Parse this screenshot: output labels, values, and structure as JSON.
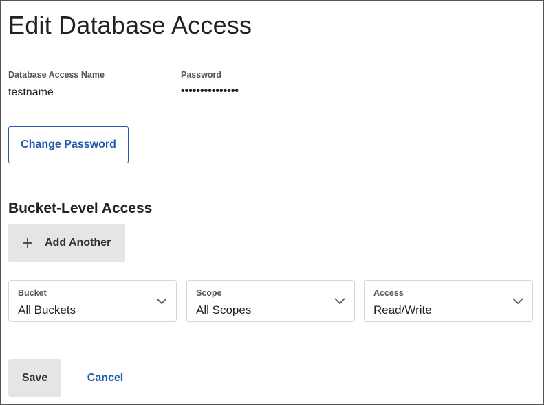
{
  "page": {
    "title": "Edit Database Access"
  },
  "credentials": {
    "name_label": "Database Access Name",
    "name_value": "testname",
    "password_label": "Password",
    "password_value": "•••••••••••••••"
  },
  "actions": {
    "change_password_label": "Change Password",
    "save_label": "Save",
    "cancel_label": "Cancel"
  },
  "bucket_access": {
    "section_title": "Bucket-Level Access",
    "add_another_label": "Add Another",
    "add_icon": "plus-icon",
    "dropdown_icon": "chevron-down-icon",
    "selects": [
      {
        "label": "Bucket",
        "value": "All Buckets"
      },
      {
        "label": "Scope",
        "value": "All Scopes"
      },
      {
        "label": "Access",
        "value": "Read/Write"
      }
    ]
  },
  "colors": {
    "accent": "#1f5da8",
    "button_gray": "#e5e5e5",
    "border": "#d6d6d6"
  }
}
